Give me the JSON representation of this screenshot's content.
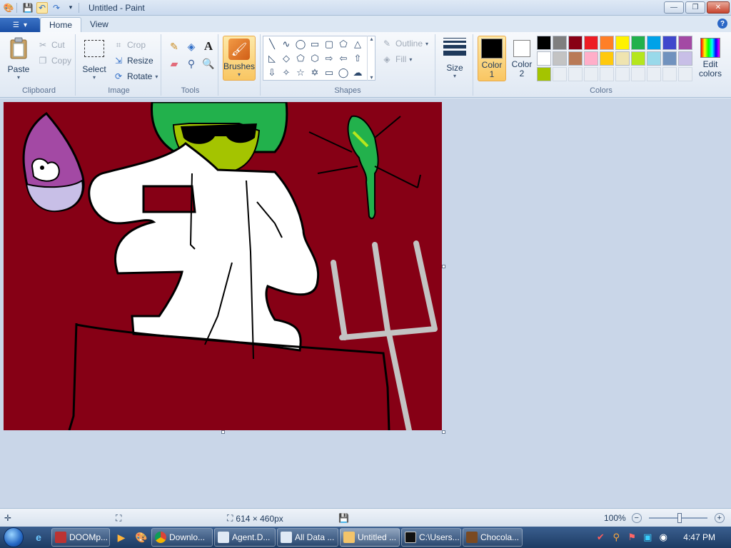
{
  "window": {
    "title": "Untitled - Paint",
    "minimize": "—",
    "maximize": "❐",
    "close": "✕"
  },
  "tabs": {
    "home": "Home",
    "view": "View",
    "help": "?"
  },
  "clipboard": {
    "label": "Clipboard",
    "paste": "Paste",
    "cut": "Cut",
    "copy": "Copy"
  },
  "image": {
    "label": "Image",
    "select": "Select",
    "crop": "Crop",
    "resize": "Resize",
    "rotate": "Rotate"
  },
  "tools": {
    "label": "Tools"
  },
  "brushes": {
    "label": "Brushes"
  },
  "shapes": {
    "label": "Shapes",
    "outline": "Outline",
    "fill": "Fill"
  },
  "size": {
    "label": "Size"
  },
  "colors": {
    "label": "Colors",
    "color1_line1": "Color",
    "color1_line2": "1",
    "color2_line1": "Color",
    "color2_line2": "2",
    "edit_line1": "Edit",
    "edit_line2": "colors",
    "color1_value": "#000000",
    "color2_value": "#ffffff",
    "palette_row1": [
      "#000000",
      "#7f7f7f",
      "#880015",
      "#ed1c24",
      "#ff7f27",
      "#fff200",
      "#22b14c",
      "#00a2e8",
      "#3f48cc",
      "#a349a4"
    ],
    "palette_row2": [
      "#ffffff",
      "#c3c3c3",
      "#b97a57",
      "#ffaec9",
      "#ffc90e",
      "#efe4b0",
      "#b5e61d",
      "#99d9ea",
      "#7092be",
      "#c8bfe7"
    ],
    "palette_row3": [
      "#a4c400"
    ]
  },
  "status": {
    "dimensions": "614 × 460px",
    "zoom": "100%"
  },
  "taskbar": {
    "items": [
      "DOOMp...",
      "Downlo...",
      "Agent.D...",
      "All Data ...",
      "Untitled ...",
      "C:\\Users...",
      "Chocola..."
    ],
    "clock": "4:47 PM"
  }
}
